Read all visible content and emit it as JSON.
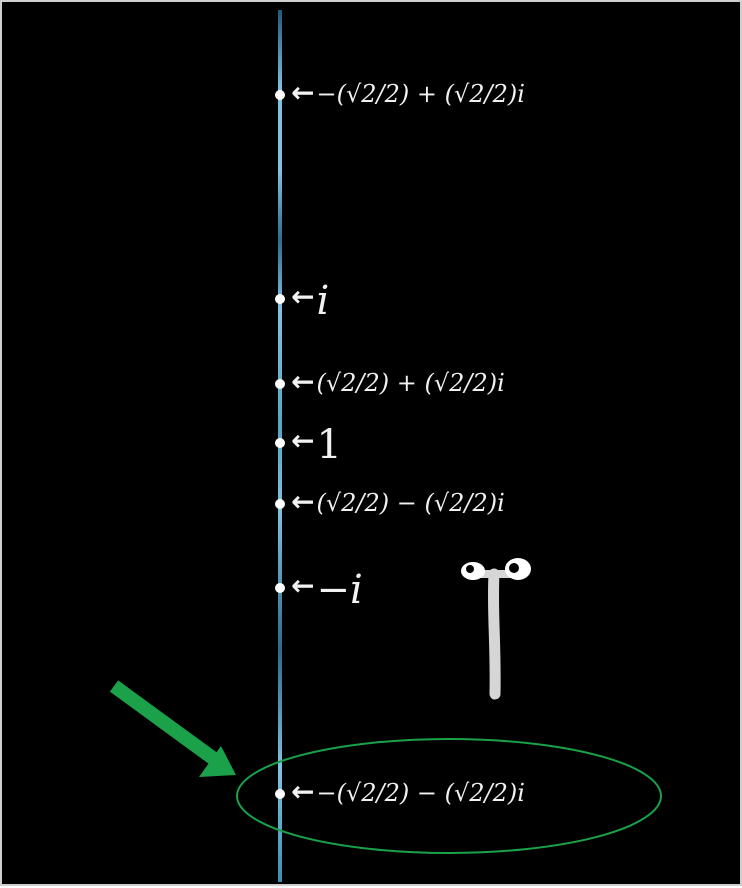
{
  "markers": [
    {
      "label": "−(√2/2) + (√2/2)i"
    },
    {
      "label": "i"
    },
    {
      "label": "(√2/2) + (√2/2)i"
    },
    {
      "label": "1"
    },
    {
      "label": "(√2/2) − (√2/2)i"
    },
    {
      "label": "−i"
    },
    {
      "label": "−(√2/2) − (√2/2)i"
    }
  ],
  "colors": {
    "background": "#000000",
    "number_line": "#7ec3e0",
    "highlight": "#1aa14a",
    "text": "#f2f2f2"
  },
  "icons": {
    "pointer_arrow": "green-arrow-icon",
    "highlight": "green-ellipse",
    "character": "pi-creature-icon"
  }
}
